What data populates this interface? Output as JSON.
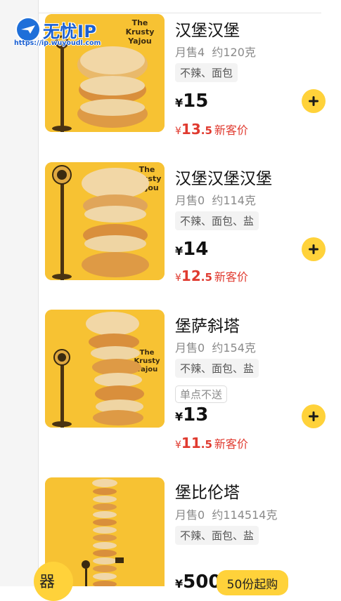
{
  "watermark": {
    "brand": "无忧IP",
    "url": "https://ip.wuyoudl.com"
  },
  "products": [
    {
      "title": "汉堡汉堡",
      "sales": "月售4",
      "weight": "约120克",
      "tags": "不辣、面包",
      "price_symbol": "¥",
      "price": "15",
      "promo_symbol": "¥",
      "promo_int": "13",
      "promo_dec": ".5",
      "promo_label": "新客价",
      "image_caption": [
        "The",
        "Krusty",
        "Yajou"
      ],
      "action": "add"
    },
    {
      "title": "汉堡汉堡汉堡",
      "sales": "月售0",
      "weight": "约114克",
      "tags": "不辣、面包、盐",
      "price_symbol": "¥",
      "price": "14",
      "promo_symbol": "¥",
      "promo_int": "12",
      "promo_dec": ".5",
      "promo_label": "新客价",
      "image_caption": [
        "The",
        "Krusty",
        "Yajou"
      ],
      "action": "add"
    },
    {
      "title": "堡萨斜塔",
      "sales": "月售0",
      "weight": "约154克",
      "tags": "不辣、面包、盐",
      "notice": "单点不送",
      "price_symbol": "¥",
      "price": "13",
      "promo_symbol": "¥",
      "promo_int": "11",
      "promo_dec": ".5",
      "promo_label": "新客价",
      "image_caption": [
        "The",
        "Krusty",
        "Yajou"
      ],
      "action": "add"
    },
    {
      "title": "堡比伦塔",
      "sales": "月售0",
      "weight": "约114514克",
      "tags": "不辣、面包、盐",
      "price_symbol": "¥",
      "price": "500",
      "min_order_label": "50份起购",
      "action": "min-order"
    }
  ],
  "cart": {
    "label": "器"
  },
  "colors": {
    "accent": "#ffd23a",
    "promo_red": "#e03a2f",
    "thumb_bg": "#f7c233"
  },
  "icons": {
    "add": "plus-icon",
    "watermark_logo": "paper-plane-icon"
  }
}
